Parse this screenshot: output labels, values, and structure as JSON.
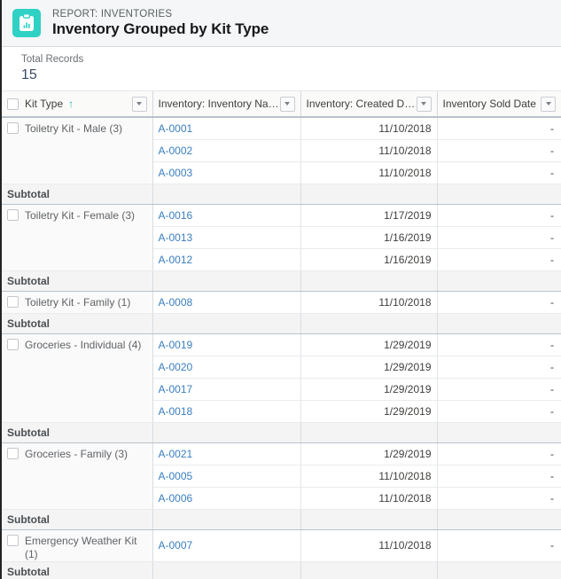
{
  "header": {
    "eyebrow": "REPORT: INVENTORIES",
    "title": "Inventory Grouped by Kit Type",
    "icon": "report-clipboard-chart-icon",
    "icon_color": "#2fd1c5"
  },
  "summary": {
    "label": "Total Records",
    "value": "15"
  },
  "table": {
    "columns": [
      {
        "label": "Kit Type",
        "sorted": true,
        "sort_arrow": "↑",
        "menu_icon": "chevron-down-icon"
      },
      {
        "label": "Inventory: Inventory Name",
        "sorted": false,
        "menu_icon": "chevron-down-icon"
      },
      {
        "label": "Inventory: Created Date",
        "sorted": false,
        "menu_icon": "chevron-down-icon"
      },
      {
        "label": "Inventory Sold Date",
        "sorted": false,
        "menu_icon": "chevron-down-icon"
      }
    ],
    "subtotal_label": "Subtotal",
    "empty_value": "-",
    "groups": [
      {
        "label": "Toiletry Kit - Male (3)",
        "rows": [
          {
            "name": "A-0001",
            "created": "11/10/2018",
            "sold": "-"
          },
          {
            "name": "A-0002",
            "created": "11/10/2018",
            "sold": "-"
          },
          {
            "name": "A-0003",
            "created": "11/10/2018",
            "sold": "-"
          }
        ]
      },
      {
        "label": "Toiletry Kit - Female (3)",
        "rows": [
          {
            "name": "A-0016",
            "created": "1/17/2019",
            "sold": "-"
          },
          {
            "name": "A-0013",
            "created": "1/16/2019",
            "sold": "-"
          },
          {
            "name": "A-0012",
            "created": "1/16/2019",
            "sold": "-"
          }
        ]
      },
      {
        "label": "Toiletry Kit - Family (1)",
        "rows": [
          {
            "name": "A-0008",
            "created": "11/10/2018",
            "sold": "-"
          }
        ]
      },
      {
        "label": "Groceries - Individual (4)",
        "rows": [
          {
            "name": "A-0019",
            "created": "1/29/2019",
            "sold": "-"
          },
          {
            "name": "A-0020",
            "created": "1/29/2019",
            "sold": "-"
          },
          {
            "name": "A-0017",
            "created": "1/29/2019",
            "sold": "-"
          },
          {
            "name": "A-0018",
            "created": "1/29/2019",
            "sold": "-"
          }
        ]
      },
      {
        "label": "Groceries - Family (3)",
        "rows": [
          {
            "name": "A-0021",
            "created": "1/29/2019",
            "sold": "-"
          },
          {
            "name": "A-0005",
            "created": "11/10/2018",
            "sold": "-"
          },
          {
            "name": "A-0006",
            "created": "11/10/2018",
            "sold": "-"
          }
        ]
      },
      {
        "label": "Emergency Weather Kit (1)",
        "rows": [
          {
            "name": "A-0007",
            "created": "11/10/2018",
            "sold": "-"
          }
        ]
      }
    ]
  }
}
